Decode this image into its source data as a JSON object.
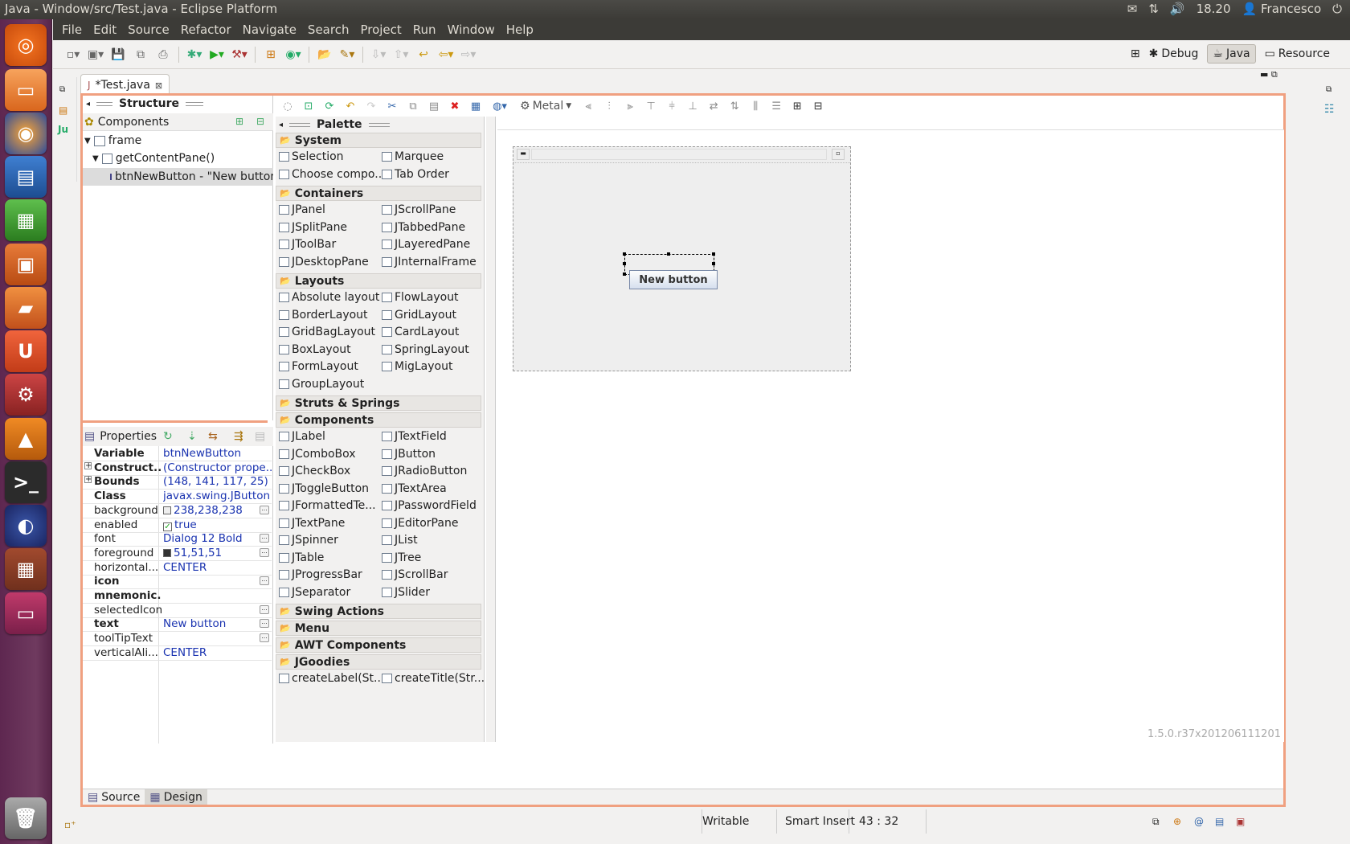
{
  "top_panel": {
    "title": "Java - Window/src/Test.java - Eclipse Platform",
    "time": "18.20",
    "user": "Francesco"
  },
  "menu": [
    "File",
    "Edit",
    "Source",
    "Refactor",
    "Navigate",
    "Search",
    "Project",
    "Run",
    "Window",
    "Help"
  ],
  "perspectives": {
    "debug": "Debug",
    "java": "Java",
    "resource": "Resource"
  },
  "editor": {
    "tab_label": "*Test.java"
  },
  "structure": {
    "title": "Structure",
    "components_label": "Components",
    "tree": [
      "frame",
      "getContentPane()",
      "btnNewButton - \"New button\""
    ]
  },
  "properties": {
    "title": "Properties",
    "rows": [
      {
        "key": "Variable",
        "value": "btnNewButton",
        "bold": true
      },
      {
        "key": "Construct...",
        "value": "(Constructor prope...",
        "bold": true,
        "expand": true
      },
      {
        "key": "Bounds",
        "value": "(148, 141, 117, 25)",
        "bold": true,
        "expand": true
      },
      {
        "key": "Class",
        "value": "javax.swing.JButton",
        "bold": true
      },
      {
        "key": "background",
        "value": "238,238,238",
        "swatch": "#eeeeee",
        "dots": true
      },
      {
        "key": "enabled",
        "value": "true",
        "check": true
      },
      {
        "key": "font",
        "value": "Dialog 12 Bold",
        "dots": true
      },
      {
        "key": "foreground",
        "value": "51,51,51",
        "swatch": "#333333",
        "dots": true
      },
      {
        "key": "horizontal...",
        "value": "CENTER"
      },
      {
        "key": "icon",
        "value": "",
        "bold": true,
        "dots": true
      },
      {
        "key": "mnemonic...",
        "value": "",
        "bold": true
      },
      {
        "key": "selectedIcon",
        "value": "",
        "dots": true
      },
      {
        "key": "text",
        "value": "New button",
        "bold": true,
        "dots": true
      },
      {
        "key": "toolTipText",
        "value": "",
        "dots": true
      },
      {
        "key": "verticalAli...",
        "value": "CENTER"
      }
    ]
  },
  "palette": {
    "title": "Palette",
    "categories": {
      "system": "System",
      "containers": "Containers",
      "layouts": "Layouts",
      "struts": "Struts & Springs",
      "components": "Components",
      "swing_actions": "Swing Actions",
      "menu": "Menu",
      "awt": "AWT Components",
      "jgoodies": "JGoodies"
    },
    "system_items": [
      "Selection",
      "Marquee",
      "Choose compo...",
      "Tab Order"
    ],
    "container_items": [
      "JPanel",
      "JScrollPane",
      "JSplitPane",
      "JTabbedPane",
      "JToolBar",
      "JLayeredPane",
      "JDesktopPane",
      "JInternalFrame"
    ],
    "layout_items": [
      "Absolute layout",
      "FlowLayout",
      "BorderLayout",
      "GridLayout",
      "GridBagLayout",
      "CardLayout",
      "BoxLayout",
      "SpringLayout",
      "FormLayout",
      "MigLayout",
      "GroupLayout"
    ],
    "component_items": [
      "JLabel",
      "JTextField",
      "JComboBox",
      "JButton",
      "JCheckBox",
      "JRadioButton",
      "JToggleButton",
      "JTextArea",
      "JFormattedTe...",
      "JPasswordField",
      "JTextPane",
      "JEditorPane",
      "JSpinner",
      "JList",
      "JTable",
      "JTree",
      "JProgressBar",
      "JScrollBar",
      "JSeparator",
      "JSlider"
    ],
    "jgoodies_items": [
      "createLabel(St...",
      "createTitle(Str..."
    ]
  },
  "design": {
    "laf": "Metal",
    "button_text": "New button",
    "version": "1.5.0.r37x201206111201"
  },
  "bottom_tabs": {
    "source": "Source",
    "design": "Design"
  },
  "status": {
    "writable": "Writable",
    "insert": "Smart Insert",
    "position": "43 : 32"
  }
}
